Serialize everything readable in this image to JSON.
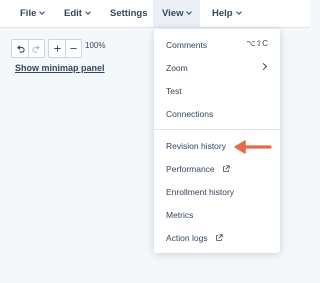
{
  "menubar": {
    "items": [
      {
        "label": "File",
        "has_chevron": true
      },
      {
        "label": "Edit",
        "has_chevron": true
      },
      {
        "label": "Settings",
        "has_chevron": false
      },
      {
        "label": "View",
        "has_chevron": true,
        "active": true
      },
      {
        "label": "Help",
        "has_chevron": true
      }
    ]
  },
  "toolbar": {
    "undo_icon": "undo-icon",
    "redo_icon": "redo-icon",
    "zoom_in_icon": "plus-icon",
    "zoom_out_icon": "minus-icon",
    "zoom_level": "100%"
  },
  "canvas": {
    "minimap_link": "Show minimap panel"
  },
  "view_menu": {
    "items": [
      {
        "label": "Comments",
        "shortcut": "⌥⇧C"
      },
      {
        "label": "Zoom",
        "submenu": true
      },
      {
        "label": "Test"
      },
      {
        "label": "Connections"
      },
      {
        "label": "Revision history",
        "highlighted_by_arrow": true
      },
      {
        "label": "Performance",
        "external": true
      },
      {
        "label": "Enrollment history"
      },
      {
        "label": "Metrics"
      },
      {
        "label": "Action logs",
        "external": true
      }
    ]
  },
  "colors": {
    "text": "#33475b",
    "arrow": "#e8684a",
    "menubar_bg": "#ffffff",
    "canvas_bg": "#f5f8fa",
    "active_tab_bg": "#eaf0f6"
  }
}
